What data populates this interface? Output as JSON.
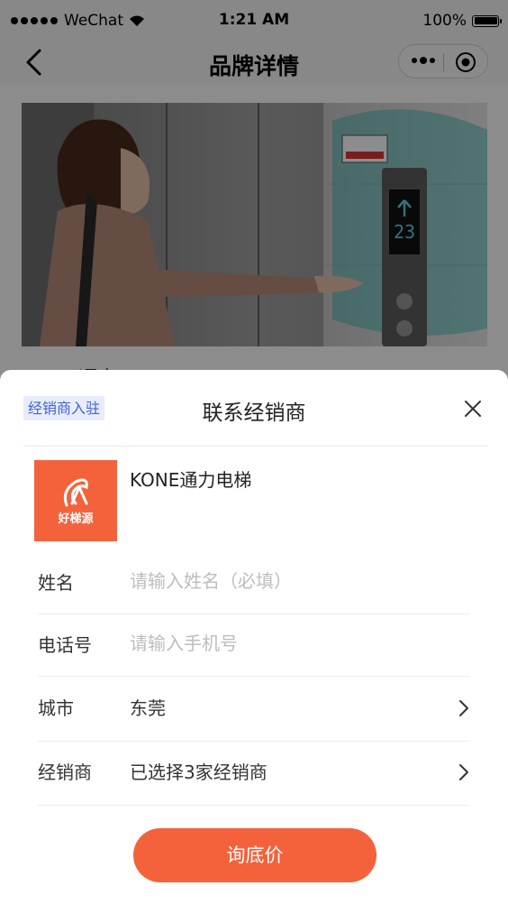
{
  "status_bar": {
    "carrier": "WeChat",
    "time": "1:21 AM",
    "battery": "100%",
    "battery_level": 1.0
  },
  "nav": {
    "title": "品牌详情"
  },
  "page": {
    "partial_text": "KONE通力"
  },
  "sheet": {
    "tag": "经销商入驻",
    "title": "联系经销商",
    "brand": {
      "logo_text": "好梯源",
      "name": "KONE通力电梯"
    },
    "fields": {
      "name": {
        "label": "姓名",
        "placeholder": "请输入姓名（必填）"
      },
      "phone": {
        "label": "电话号",
        "placeholder": "请输入手机号"
      },
      "city": {
        "label": "城市",
        "value": "东莞"
      },
      "dealer": {
        "label": "经销商",
        "value": "已选择3家经销商"
      }
    },
    "submit_label": "询底价"
  },
  "colors": {
    "accent": "#f3623b",
    "tag_bg": "#e8ecfb",
    "tag_text": "#3f63d8"
  },
  "icons": {
    "back": "chevron-left-icon",
    "more": "more-dots-icon",
    "close_mini": "target-circle-icon",
    "sheet_close": "close-icon",
    "row_arrow": "chevron-right-icon"
  }
}
